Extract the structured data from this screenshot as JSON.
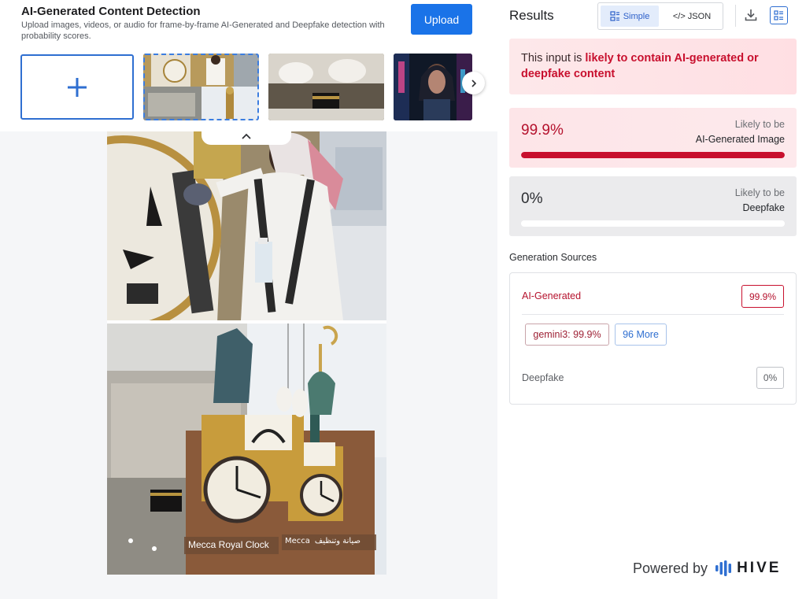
{
  "header": {
    "title": "AI-Generated Content Detection",
    "description": "Upload images, videos, or audio for frame-by-frame AI-Generated and Deepfake detection with probability scores.",
    "upload_label": "Upload"
  },
  "carousel": {
    "add_icon": "plus-icon",
    "next_icon": "chevron-right-icon",
    "collapse_icon": "chevron-up-icon"
  },
  "preview": {
    "caption_left": "Mecca Royal Clock",
    "caption_right_latin": "Mecca",
    "caption_right_arabic": "صيانة وتنظيف"
  },
  "results": {
    "title": "Results",
    "view_simple": "Simple",
    "view_json": "</> JSON",
    "icons": [
      "download-icon",
      "list-view-icon"
    ],
    "verdict_prefix": "This input is ",
    "verdict_highlight": "likely to contain AI-generated or deepfake content",
    "ai_score": {
      "value_text": "99.9%",
      "value": 0.999,
      "label_small": "Likely to be",
      "label_big": "AI-Generated Image"
    },
    "deepfake_score": {
      "value_text": "0%",
      "value": 0,
      "label_small": "Likely to be",
      "label_big": "Deepfake"
    },
    "sources": {
      "heading": "Generation Sources",
      "ai_label": "AI-Generated",
      "ai_value": "99.9%",
      "model_chip": "gemini3: 99.9%",
      "more_chip": "96 More",
      "deepfake_label": "Deepfake",
      "deepfake_value": "0%"
    }
  },
  "footer": {
    "powered_by": "Powered by",
    "brand": "HIVE"
  },
  "colors": {
    "accent": "#1a73e8",
    "danger": "#c8102e"
  }
}
